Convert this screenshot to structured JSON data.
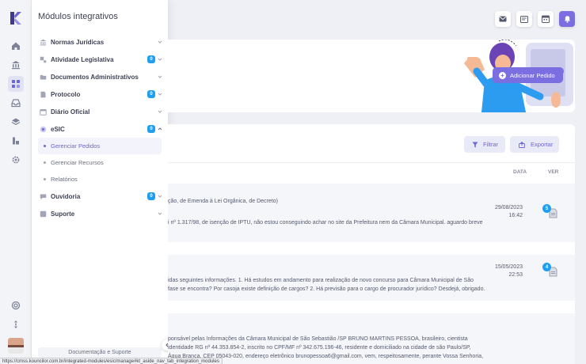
{
  "panel": {
    "title": "Módulos integrativos",
    "items": [
      {
        "label": "Normas Jurídicas",
        "badge": ""
      },
      {
        "label": "Atividade Legislativa",
        "badge": "0"
      },
      {
        "label": "Documentos Administrativos",
        "badge": ""
      },
      {
        "label": "Protocolo",
        "badge": "0"
      },
      {
        "label": "Diário Oficial",
        "badge": ""
      },
      {
        "label": "eSIC",
        "badge": "0"
      },
      {
        "label": "Ouvidoria",
        "badge": "0"
      },
      {
        "label": "Suporte",
        "badge": ""
      }
    ],
    "esic_sub": [
      "Gerenciar Pedidos",
      "Gerenciar Recursos",
      "Relatórios"
    ],
    "footer": "Documentação e Suporte"
  },
  "hero": {
    "add_button": "Adicionar Pedido"
  },
  "list": {
    "filter_label": "Filtrar",
    "export_label": "Exportar",
    "col_date": "DATA",
    "col_view": "VER",
    "rows": [
      {
        "line1": "ção, de Emenda à Lei Orgânica, de Decreto)",
        "line2": "i nº 1.317/98, de isenção de IPTU, não estou conseguindo achar no site da Prefeitura nem da Câmara Municipal. aguardo breve",
        "line3": "",
        "date": "29/08/2023",
        "time": "16:42",
        "badge": "5"
      },
      {
        "line1": "idas seguintes informações. 1. Há estudos em andamento para realização de novo concurso para Câmara Municipal de São",
        "line2": "fase se encontra? Por casoja existe definição de cargos? 2. Há previsão para o cargo de procurador jurídico? Desdejá, obrigado.",
        "line3": "",
        "date": "15/05/2023",
        "time": "22:53",
        "badge": "4"
      },
      {
        "line1": "ponsável pelas Informações da Câmara Municipal de São Sebastião /SP BRUNO MARTINS PESSOA, brasileiro, cientista",
        "line2": "identidade RG nº 44.353.854-2, inscrito no CPF/MF nº 342.675.196-46, residente e domiciliado na cidade de são Paulo/SP,",
        "line3": "Água Branca, CEP 05043-020, endereço eletrônico brunopessoa6@gmail.com, vem, respeitosamente, perante Vossa Senhoria,",
        "date": "",
        "time": "",
        "badge": ""
      }
    ]
  },
  "statusbar": "https://cmss.kouncilor.com.br/integrated-modules/esic/manage#kt_aside_nav_tab_integration_modules",
  "colors": {
    "accent": "#7a6ee0",
    "badge": "#1e9ff2"
  }
}
